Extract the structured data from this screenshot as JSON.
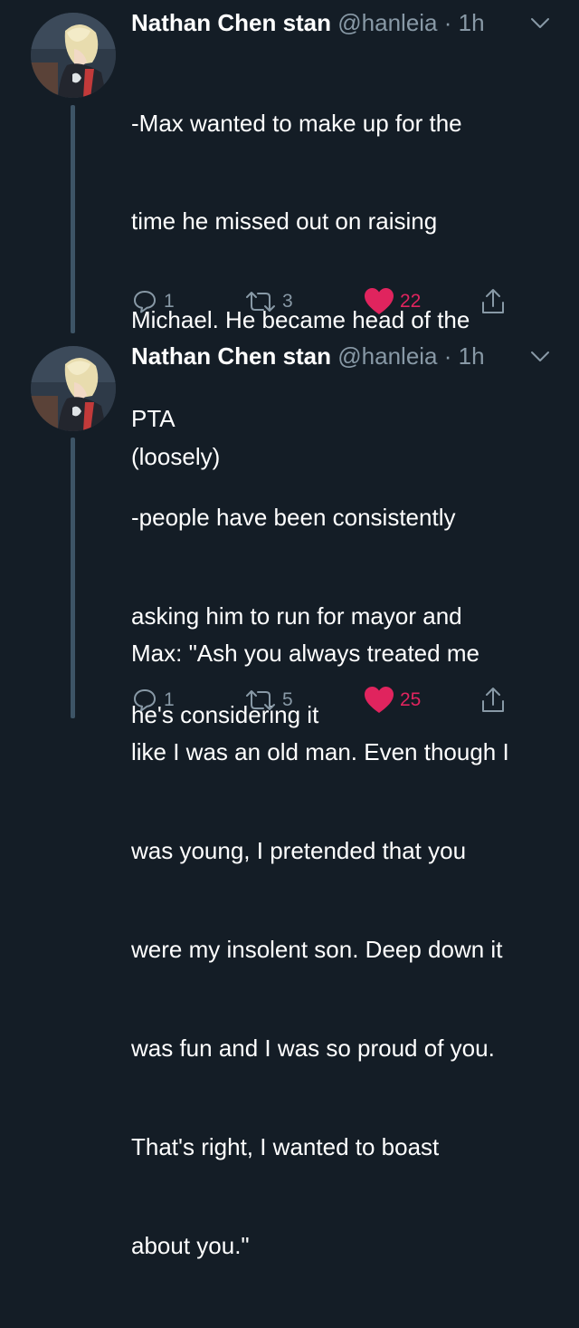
{
  "tweets": [
    {
      "name": "Nathan Chen stan",
      "handle": "@hanleia",
      "separator": "·",
      "time": "1h",
      "lines": [
        "-Max wanted to make up for the",
        "time he missed out on raising",
        "Michael. He became head of the",
        "PTA",
        "-people have been consistently",
        "asking him to run for mayor and",
        "he's considering it"
      ],
      "replies": "1",
      "retweets": "3",
      "likes": "22",
      "icons": [
        "reply-icon",
        "retweet-icon",
        "heart-icon",
        "share-icon",
        "chevron-down-icon"
      ]
    },
    {
      "name": "Nathan Chen stan",
      "handle": "@hanleia",
      "separator": "·",
      "time": "1h",
      "lines": [
        "(loosely)",
        "",
        "Max: \"Ash you always treated me",
        "like I was an old man. Even though I",
        "was young, I pretended that you",
        "were my insolent son. Deep down it",
        "was fun and I was so proud of you.",
        "That's right, I wanted to boast",
        "about you.\""
      ],
      "replies": "1",
      "retweets": "5",
      "likes": "25",
      "icons": [
        "reply-icon",
        "retweet-icon",
        "heart-icon",
        "share-icon",
        "chevron-down-icon"
      ]
    }
  ],
  "colors": {
    "background": "#141d26",
    "text": "#ffffff",
    "secondary": "#8899a6",
    "like": "#e0245e",
    "thread_line": "#3d5466"
  }
}
